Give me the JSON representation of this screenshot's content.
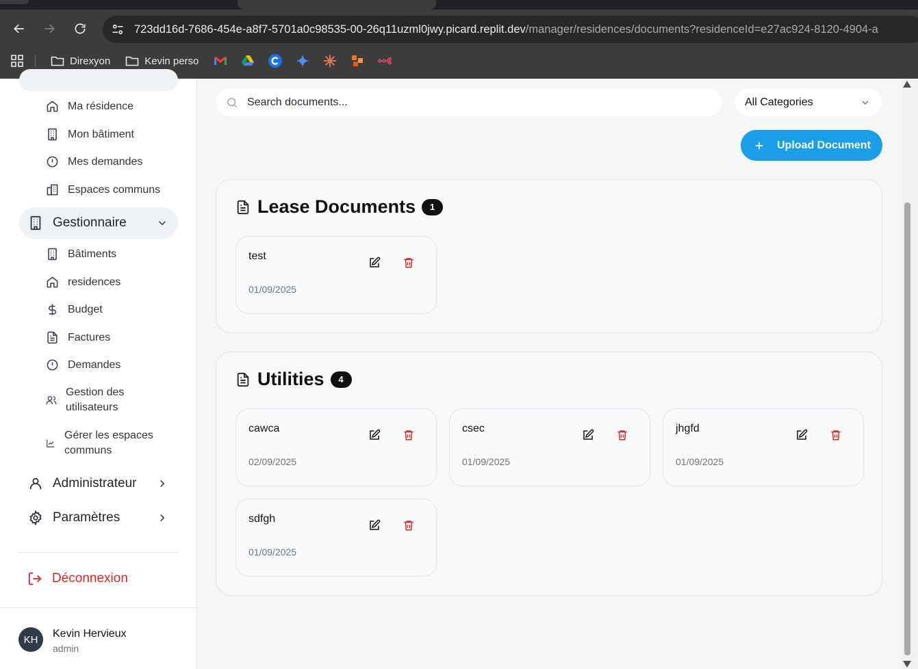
{
  "browser": {
    "url_main": "723dd16d-7686-454e-a8f7-5701a0c98535-00-26q11uzml0jwy.picard.replit.dev",
    "url_path": "/manager/residences/documents?residenceId=e27ac924-8120-4904-a",
    "bookmarks": [
      {
        "label": "Direxyon",
        "icon": "folder-icon"
      },
      {
        "label": "Kevin perso",
        "icon": "folder-icon"
      }
    ],
    "bookmark_icons": [
      "gmail-icon",
      "google-drive-icon",
      "c-app-icon",
      "gemini-icon",
      "claude-icon",
      "app-grid-orange-icon",
      "n8n-icon"
    ]
  },
  "sidebar": {
    "resident_items": [
      {
        "label": "Ma résidence",
        "icon": "home-icon"
      },
      {
        "label": "Mon bâtiment",
        "icon": "building-icon"
      },
      {
        "label": "Mes demandes",
        "icon": "alert-circle-icon"
      },
      {
        "label": "Espaces communs",
        "icon": "common-spaces-icon"
      }
    ],
    "manager": {
      "label": "Gestionnaire",
      "items": [
        {
          "label": "Bâtiments",
          "icon": "building-icon"
        },
        {
          "label": "residences",
          "icon": "home-icon"
        },
        {
          "label": "Budget",
          "icon": "dollar-icon"
        },
        {
          "label": "Factures",
          "icon": "file-text-icon"
        },
        {
          "label": "Demandes",
          "icon": "alert-circle-icon"
        },
        {
          "label": "Gestion des utilisateurs",
          "line1": "Gestion des",
          "line2": "utilisateurs",
          "icon": "users-icon"
        },
        {
          "label": "Gérer les espaces communs",
          "line1": "Gérer les espaces",
          "line2": "communs",
          "icon": "chart-icon"
        }
      ]
    },
    "admin_label": "Administrateur",
    "settings_label": "Paramètres",
    "logout_label": "Déconnexion",
    "user": {
      "initials": "KH",
      "name": "Kevin Hervieux",
      "role": "admin"
    }
  },
  "toolbar": {
    "search_placeholder": "Search documents...",
    "category_value": "All Categories",
    "upload_label": "Upload Document"
  },
  "sections": [
    {
      "title": "Lease Documents",
      "count": "1",
      "documents": [
        {
          "name": "test",
          "date": "01/09/2025"
        }
      ]
    },
    {
      "title": "Utilities",
      "count": "4",
      "documents": [
        {
          "name": "cawca",
          "date": "02/09/2025"
        },
        {
          "name": "csec",
          "date": "01/09/2025"
        },
        {
          "name": "jhgfd",
          "date": "01/09/2025"
        },
        {
          "name": "sdfgh",
          "date": "01/09/2025"
        }
      ]
    }
  ],
  "colors": {
    "accent": "#1a9ee8",
    "danger": "#dc2626",
    "badge": "#111111"
  }
}
